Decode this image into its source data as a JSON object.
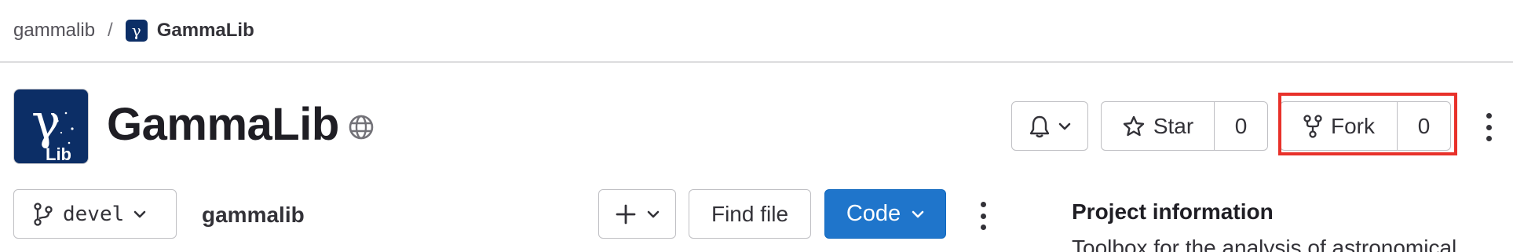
{
  "breadcrumb": {
    "group": "gammalib",
    "separator": "/",
    "project_avatar_glyph": "γ",
    "current": "GammaLib"
  },
  "project": {
    "title": "GammaLib",
    "avatar_glyph": "γ",
    "avatar_text": "Lib",
    "visibility_icon": "globe-icon"
  },
  "actions": {
    "notifications_icon": "bell-icon",
    "star_label": "Star",
    "star_count": "0",
    "fork_label": "Fork",
    "fork_count": "0",
    "more_icon": "kebab-icon"
  },
  "repo_toolbar": {
    "branch": "devel",
    "path": "gammalib",
    "add_icon": "plus-icon",
    "find_file_label": "Find file",
    "code_label": "Code"
  },
  "sidebar": {
    "title": "Project information",
    "description": "Toolbox for the analysis of astronomical"
  },
  "colors": {
    "primary_button": "#1f75cb",
    "highlight": "#e8312a",
    "avatar_bg": "#0c2e66"
  }
}
